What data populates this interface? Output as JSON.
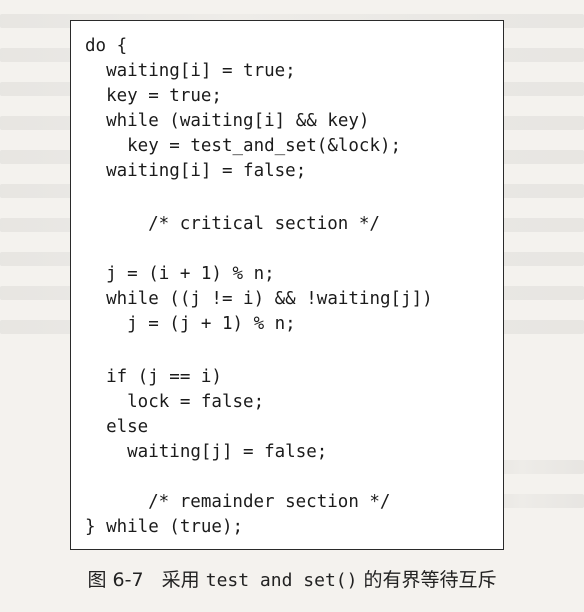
{
  "figure": {
    "code_lines": [
      "do {",
      "  waiting[i] = true;",
      "  key = true;",
      "  while (waiting[i] && key)",
      "    key = test_and_set(&lock);",
      "  waiting[i] = false;",
      "",
      "    /* critical section */",
      "",
      "  j = (i + 1) % n;",
      "  while ((j != i) && !waiting[j])",
      "    j = (j + 1) % n;",
      "",
      "  if (j == i)",
      "    lock = false;",
      "  else",
      "    waiting[j] = false;",
      "",
      "    /* remainder section */",
      "} while (true);"
    ],
    "caption": {
      "number": "图 6-7",
      "prefix": "采用",
      "code": "test and set()",
      "suffix": "的有界等待互斥"
    }
  }
}
